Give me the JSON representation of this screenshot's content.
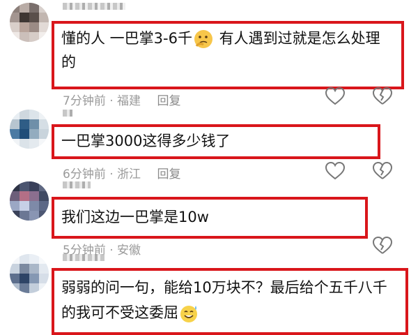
{
  "comments": [
    {
      "text_parts": [
        "懂的人  一巴掌3-6千",
        "  有人遇到过就是怎么处理的"
      ],
      "emoji": "thinking-face",
      "time": "7分钟前",
      "location": "福建",
      "reply": "回复"
    },
    {
      "text_parts": [
        "一巴掌3000这得多少钱了"
      ],
      "time": "6分钟前",
      "location": "浙江",
      "reply": "回复"
    },
    {
      "text_parts": [
        "我们这边一巴掌是10w"
      ],
      "time": "5分钟前",
      "location": "安徽",
      "reply": "回复"
    },
    {
      "text_parts": [
        "弱弱的问一句，能给10万块不？最后给个五千八千的我可不受这委屈"
      ],
      "emoji": "sweat-smile-face"
    }
  ],
  "colors": {
    "highlight_border": "#d9161b",
    "meta_text": "#9a9a9a"
  }
}
